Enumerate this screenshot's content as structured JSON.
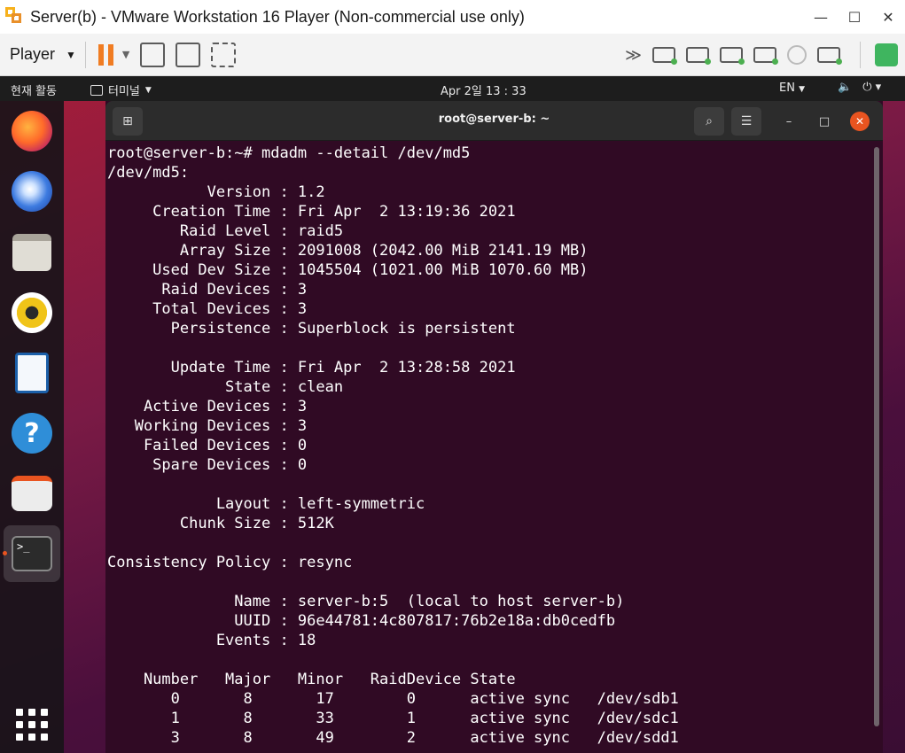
{
  "vmware": {
    "title": "Server(b) - VMware Workstation 16 Player (Non-commercial use only)",
    "player_menu": "Player",
    "window_controls": [
      "minimize-icon",
      "maximize-icon",
      "close-icon"
    ],
    "toolbar_icons": [
      "pause-icon",
      "send-ctrl-alt-del-icon",
      "fullscreen-icon",
      "unity-icon"
    ],
    "device_icons": [
      "hard-disk-icon",
      "network-adapter-icon",
      "usb-icon",
      "sound-card-icon",
      "cd-dvd-icon",
      "printer-icon",
      "message-log-icon"
    ]
  },
  "gnome": {
    "activities": "현재 활동",
    "app_menu": "터미널",
    "clock": "Apr 2일  13 : 33",
    "lang": "EN",
    "tray_icons": [
      "volume-icon",
      "power-icon"
    ]
  },
  "dock": {
    "items": [
      "firefox-icon",
      "thunderbird-icon",
      "files-icon",
      "rhythmbox-icon",
      "libreoffice-writer-icon",
      "help-icon",
      "software-store-icon",
      "terminal-icon"
    ],
    "show_apps": "show-applications-icon"
  },
  "terminal": {
    "title": "root@server-b: ~",
    "lines": [
      "root@server-b:~# mdadm --detail /dev/md5",
      "/dev/md5:",
      "           Version : 1.2",
      "     Creation Time : Fri Apr  2 13:19:36 2021",
      "        Raid Level : raid5",
      "        Array Size : 2091008 (2042.00 MiB 2141.19 MB)",
      "     Used Dev Size : 1045504 (1021.00 MiB 1070.60 MB)",
      "      Raid Devices : 3",
      "     Total Devices : 3",
      "       Persistence : Superblock is persistent",
      "",
      "       Update Time : Fri Apr  2 13:28:58 2021",
      "             State : clean",
      "    Active Devices : 3",
      "   Working Devices : 3",
      "    Failed Devices : 0",
      "     Spare Devices : 0",
      "",
      "            Layout : left-symmetric",
      "        Chunk Size : 512K",
      "",
      "Consistency Policy : resync",
      "",
      "              Name : server-b:5  (local to host server-b)",
      "              UUID : 96e44781:4c807817:76b2e18a:db0cedfb",
      "            Events : 18",
      "",
      "    Number   Major   Minor   RaidDevice State",
      "       0       8       17        0      active sync   /dev/sdb1",
      "       1       8       33        1      active sync   /dev/sdc1",
      "       3       8       49        2      active sync   /dev/sdd1"
    ]
  }
}
